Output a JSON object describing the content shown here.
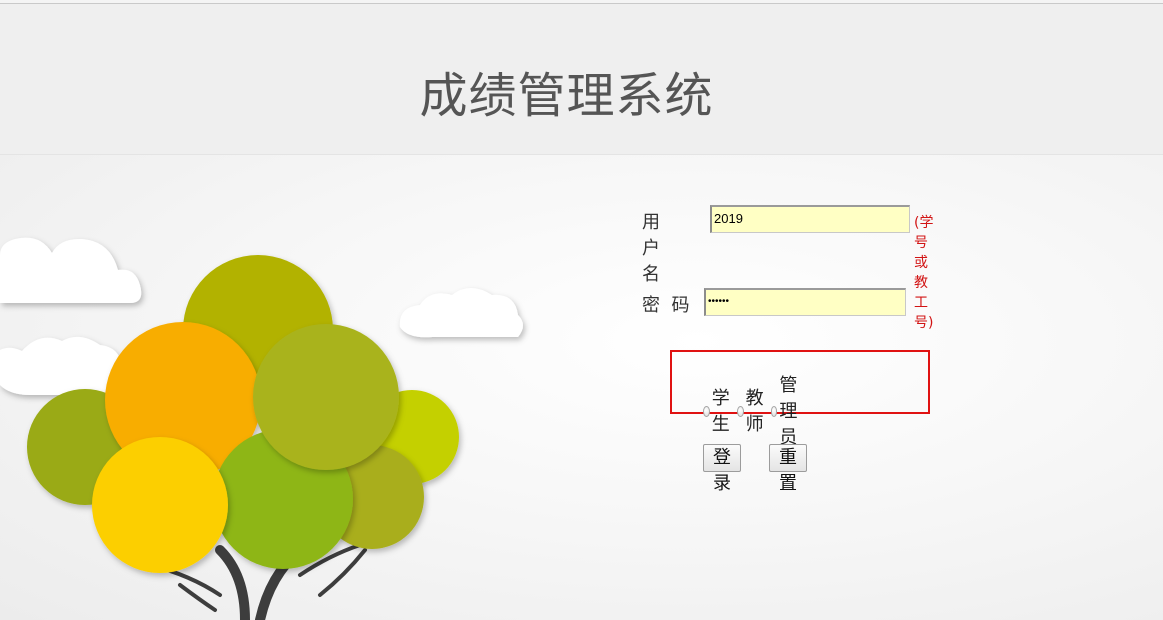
{
  "header": {
    "title": "成绩管理系统"
  },
  "login_form": {
    "username_label": "用户名",
    "username_value": "2019",
    "username_hint": "(学号或教工号)",
    "password_label": "密  码",
    "password_masked": "••••••",
    "roles": [
      {
        "label": "学生",
        "selected": false
      },
      {
        "label": "教师",
        "selected": false
      },
      {
        "label": "管理员",
        "selected": false
      }
    ],
    "login_button": "登录",
    "reset_button": "重置"
  },
  "colors": {
    "input_bg": "#ffffc4",
    "hint_red": "#d21414",
    "highlight_box": "#e01212",
    "title_gray": "#555555"
  },
  "illustration": {
    "icon": "tree-with-clouds-illustration"
  }
}
